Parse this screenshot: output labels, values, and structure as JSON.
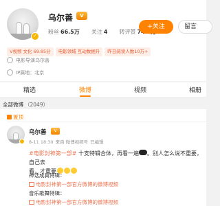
{
  "profile": {
    "username": "乌尔善",
    "vip_icon_label": "V",
    "stats": {
      "fans_label": "粉丝",
      "fans_value": "66.5万",
      "follow_label": "关注",
      "follow_value": "4",
      "likes_label": "转评赞",
      "likes_value": "74.9万"
    },
    "follow_button": "+关注",
    "message_button": "留言",
    "tags": {
      "vip": "V视频 文化 69.85分",
      "field": "电影领域 互动数据升",
      "read": "昨日阅读人数10万+"
    },
    "info": {
      "profession": "电影导演乌尔善",
      "ip": "IP属地：北京"
    }
  },
  "tabs": [
    "精选",
    "微博",
    "视频",
    "相册"
  ],
  "all_bar": {
    "label": "全部微博",
    "count": "（2049）"
  },
  "post": {
    "pinned_label": "置顶",
    "name": "乌尔善",
    "time": "8-11 18:30",
    "source": "来自 微博视频号",
    "edited": "已编辑",
    "hashtag": "#电影封神第一部#",
    "text_after_hashtag": " 十支特辑合体，再看一遍",
    "text_line1_tail": "。别人怎么说不重要，自己去",
    "text_line2": "看，才重要",
    "section1_title": "神话成真特辑：",
    "section1_link": "电影封神第一部官方微博的微博视频",
    "section2_title": "音乐歌舞特辑：",
    "section2_link": "电影封神第一部官方微博的微博视频"
  }
}
